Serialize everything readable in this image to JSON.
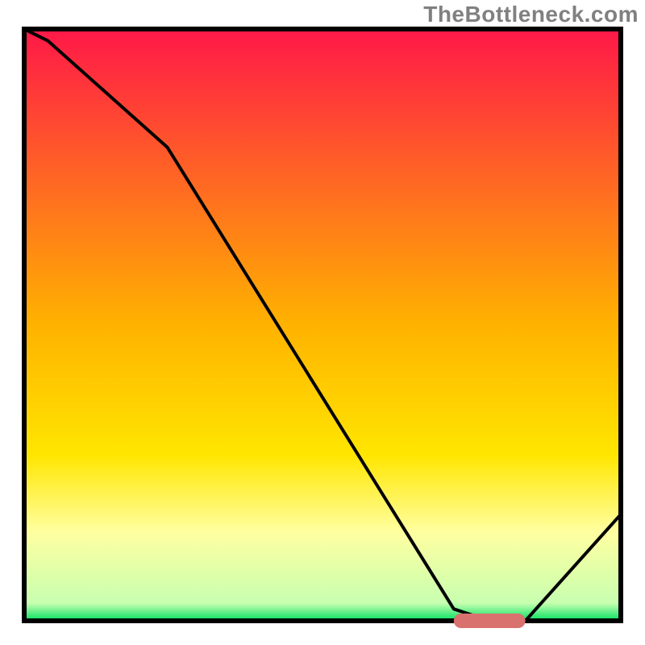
{
  "watermark": "TheBottleneck.com",
  "chart_data": {
    "type": "line",
    "title": "",
    "xlabel": "",
    "ylabel": "",
    "xlim": [
      0,
      100
    ],
    "ylim": [
      0,
      100
    ],
    "x": [
      0,
      4,
      24,
      72,
      78,
      84,
      100
    ],
    "values": [
      100,
      98,
      80,
      2,
      0,
      0,
      18
    ],
    "optimal_marker": {
      "x_start": 72,
      "x_end": 84
    },
    "background_gradient": {
      "stops": [
        {
          "pos": 0.0,
          "color": "#ff1848"
        },
        {
          "pos": 0.5,
          "color": "#ffb200"
        },
        {
          "pos": 0.72,
          "color": "#ffe600"
        },
        {
          "pos": 0.85,
          "color": "#ffffa0"
        },
        {
          "pos": 0.97,
          "color": "#c8ffb0"
        },
        {
          "pos": 1.0,
          "color": "#00e060"
        }
      ]
    }
  }
}
